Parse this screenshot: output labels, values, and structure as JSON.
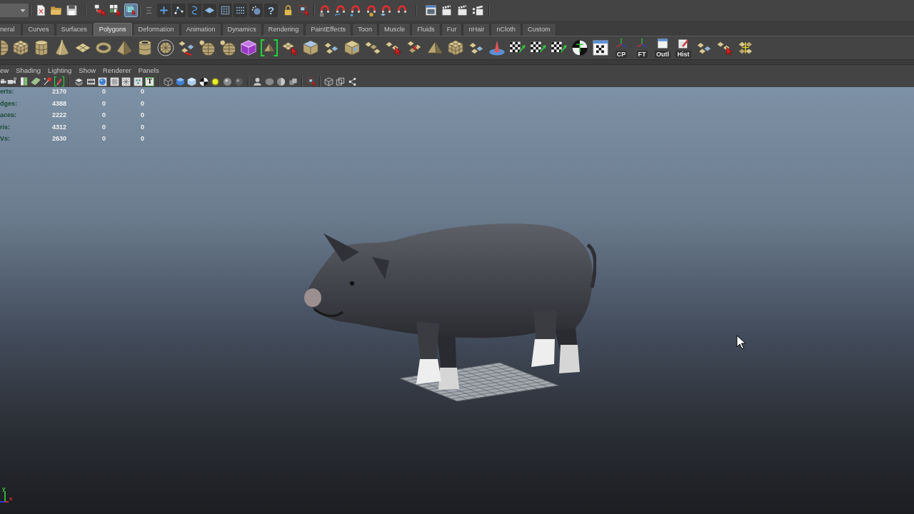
{
  "status_line": {
    "selection_mask": [
      {
        "on": false
      },
      {
        "on": false
      },
      {
        "on": true
      }
    ],
    "help_label": "?"
  },
  "shelf": {
    "tabs": [
      {
        "label": "neral",
        "selected": false
      },
      {
        "label": "Curves",
        "selected": false
      },
      {
        "label": "Surfaces",
        "selected": false
      },
      {
        "label": "Polygons",
        "selected": true
      },
      {
        "label": "Deformation",
        "selected": false
      },
      {
        "label": "Animation",
        "selected": false
      },
      {
        "label": "Dynamics",
        "selected": false
      },
      {
        "label": "Rendering",
        "selected": false
      },
      {
        "label": "PaintEffects",
        "selected": false
      },
      {
        "label": "Toon",
        "selected": false
      },
      {
        "label": "Muscle",
        "selected": false
      },
      {
        "label": "Fluids",
        "selected": false
      },
      {
        "label": "Fur",
        "selected": false
      },
      {
        "label": "nHair",
        "selected": false
      },
      {
        "label": "nCloth",
        "selected": false
      },
      {
        "label": "Custom",
        "selected": false
      }
    ],
    "tools": [
      {
        "selected": false
      },
      {
        "selected": false
      },
      {
        "selected": false
      },
      {
        "selected": false
      },
      {
        "selected": false
      },
      {
        "selected": false
      },
      {
        "selected": false
      },
      {
        "selected": false
      },
      {
        "selected": false
      },
      {
        "selected": false
      },
      {
        "selected": false
      },
      {
        "selected": false
      },
      {
        "selected": false
      },
      {
        "selected": true
      },
      {
        "selected": false
      },
      {
        "selected": false
      },
      {
        "selected": false
      },
      {
        "selected": false
      },
      {
        "selected": false
      },
      {
        "selected": false
      },
      {
        "selected": false
      },
      {
        "selected": false
      },
      {
        "selected": false
      },
      {
        "selected": false
      },
      {
        "selected": false
      },
      {
        "selected": false
      },
      {
        "selected": false
      },
      {
        "selected": false
      },
      {
        "selected": false
      },
      {
        "selected": false
      },
      {
        "label": "CP",
        "selected": false
      },
      {
        "label": "FT",
        "selected": false
      },
      {
        "label": "Outl",
        "selected": false
      },
      {
        "label": "Hist",
        "selected": false
      },
      {
        "selected": false
      },
      {
        "selected": false
      },
      {
        "selected": false
      }
    ]
  },
  "panel": {
    "menus": [
      "ew",
      "Shading",
      "Lighting",
      "Show",
      "Renderer",
      "Panels"
    ],
    "toolbar_toggles": [
      {
        "on": false
      },
      {
        "on": false
      },
      {
        "on": false
      },
      {
        "on": false
      },
      {
        "on": false
      },
      {
        "on": true
      }
    ],
    "text_toggle_label": "T"
  },
  "viewport": {
    "hud": [
      {
        "label": "erts:",
        "values": [
          "2170",
          "0",
          "0"
        ]
      },
      {
        "label": "dges:",
        "values": [
          "4388",
          "0",
          "0"
        ]
      },
      {
        "label": "aces:",
        "values": [
          "2222",
          "0",
          "0"
        ]
      },
      {
        "label": "ris:",
        "values": [
          "4312",
          "0",
          "0"
        ]
      },
      {
        "label": "Vs:",
        "values": [
          "2630",
          "0",
          "0"
        ]
      }
    ],
    "axis_labels": [
      "y",
      "x"
    ]
  }
}
